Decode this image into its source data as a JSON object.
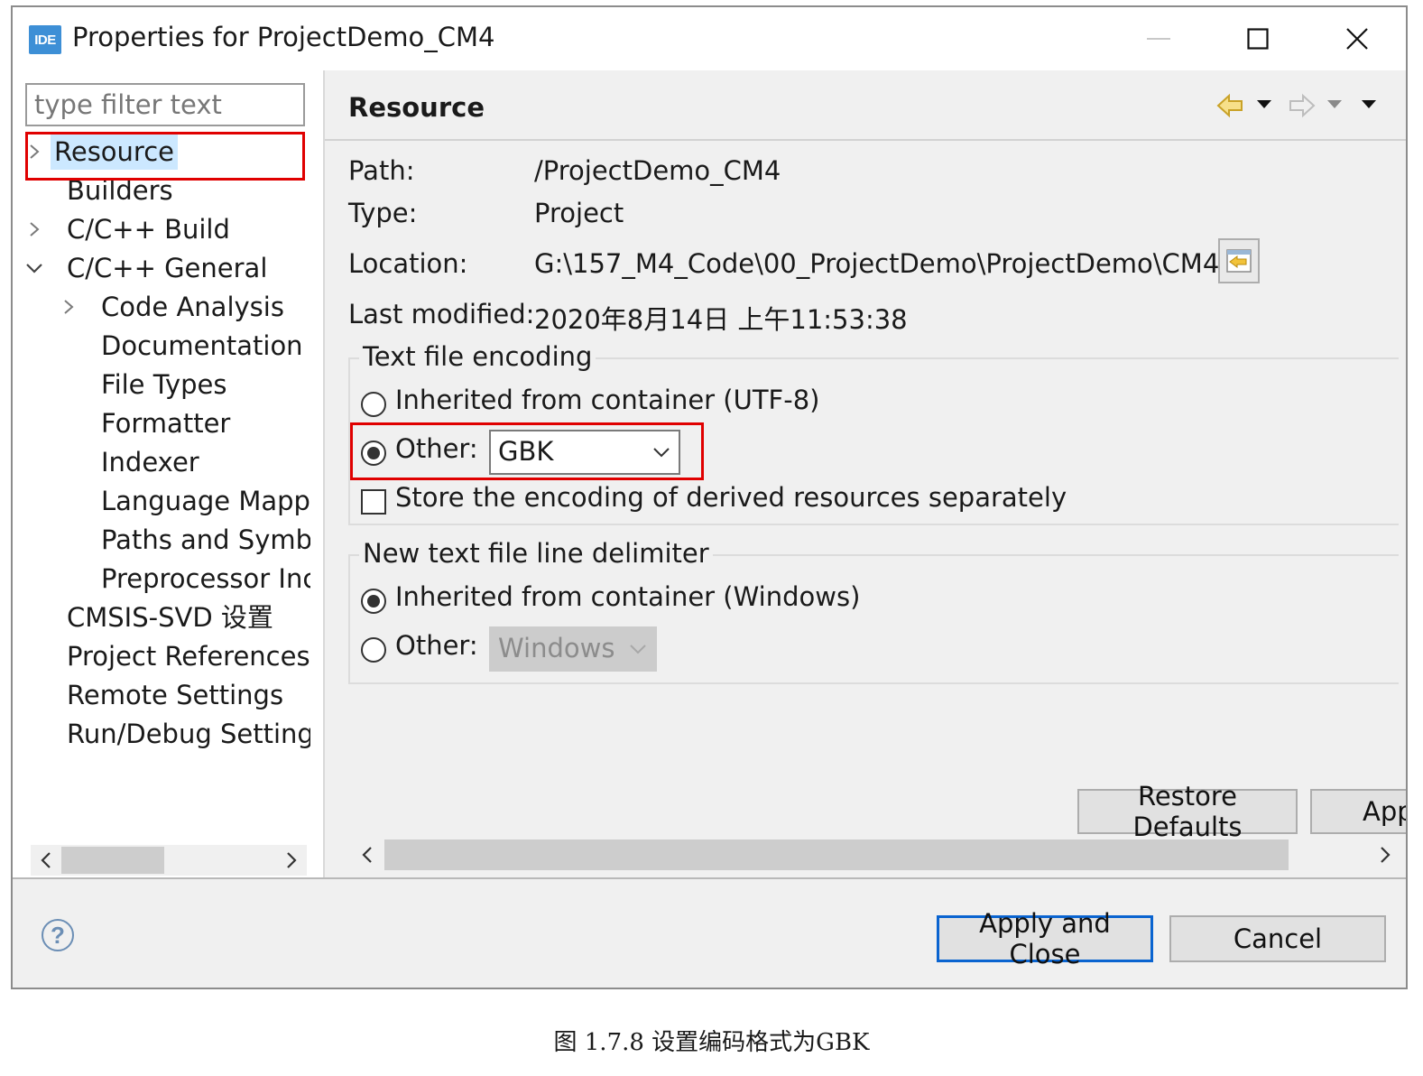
{
  "window": {
    "icon_label": "IDE",
    "title": "Properties for ProjectDemo_CM4"
  },
  "sidebar": {
    "filter_placeholder": "type filter text",
    "items": [
      {
        "label": "Resource",
        "selected": true,
        "chevron": "right"
      },
      {
        "label": "Builders"
      },
      {
        "label": "C/C++ Build",
        "chevron": "right"
      },
      {
        "label": "C/C++ General",
        "chevron": "down"
      },
      {
        "label": "Code Analysis",
        "chevron": "right",
        "indent": 1
      },
      {
        "label": "Documentation",
        "indent": 1
      },
      {
        "label": "File Types",
        "indent": 1
      },
      {
        "label": "Formatter",
        "indent": 1
      },
      {
        "label": "Indexer",
        "indent": 1
      },
      {
        "label": "Language Mappings",
        "indent": 1
      },
      {
        "label": "Paths and Symbols",
        "indent": 1
      },
      {
        "label": "Preprocessor Include Paths",
        "indent": 1
      },
      {
        "label": "CMSIS-SVD 设置"
      },
      {
        "label": "Project References"
      },
      {
        "label": "Remote Settings"
      },
      {
        "label": "Run/Debug Settings"
      }
    ]
  },
  "page": {
    "title": "Resource",
    "info": {
      "path_label": "Path:",
      "path_value": "/ProjectDemo_CM4",
      "type_label": "Type:",
      "type_value": "Project",
      "location_label": "Location:",
      "location_value": "G:\\157_M4_Code\\00_ProjectDemo\\ProjectDemo\\CM4",
      "modified_label": "Last modified:",
      "modified_value": "2020年8月14日 上午11:53:38"
    },
    "encoding": {
      "group_title": "Text file encoding",
      "inherited_label": "Inherited from container (UTF-8)",
      "other_label": "Other:",
      "other_value": "GBK",
      "store_label": "Store the encoding of derived resources separately"
    },
    "delimiter": {
      "group_title": "New text file line delimiter",
      "inherited_label": "Inherited from container (Windows)",
      "other_label": "Other:",
      "other_value": "Windows"
    },
    "restore_defaults": "Restore Defaults",
    "apply": "Apply"
  },
  "footer": {
    "help_glyph": "?",
    "apply_close": "Apply and Close",
    "cancel": "Cancel"
  },
  "caption": "图 1.7.8 设置编码格式为GBK",
  "colors": {
    "highlight_box": "#e00000",
    "selection": "#cce8ff",
    "default_button_border": "#0a64d0",
    "panel_bg": "#f0f0f0"
  }
}
